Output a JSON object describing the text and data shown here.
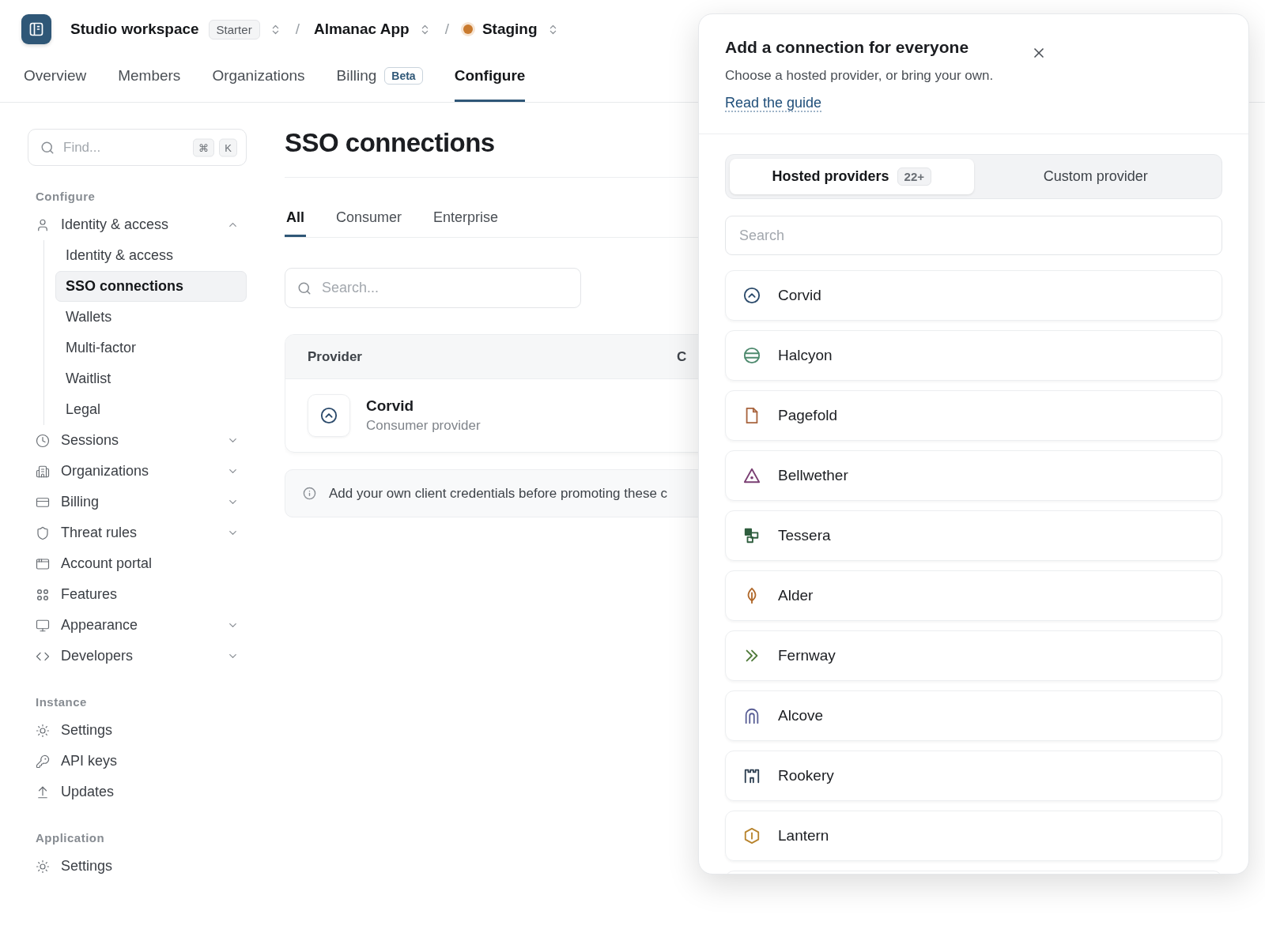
{
  "topbar": {
    "workspace": "Studio workspace",
    "plan": "Starter",
    "separator_1": "/",
    "app": "Almanac App",
    "separator_2": "/",
    "environment": "Staging"
  },
  "nav_tabs": [
    {
      "label": "Overview",
      "selected": false
    },
    {
      "label": "Members",
      "selected": false
    },
    {
      "label": "Organizations",
      "selected": false
    },
    {
      "label": "Billing",
      "badge": "Beta",
      "selected": false
    },
    {
      "label": "Configure",
      "selected": true
    }
  ],
  "sidebar": {
    "search": {
      "placeholder": "Find...",
      "keys": [
        "⌘",
        "K"
      ]
    },
    "sections": [
      {
        "title": "Configure",
        "items": [
          {
            "label": "Identity & access",
            "kind": "group",
            "expanded": true,
            "selected": false,
            "children": [
              {
                "label": "Identity & access",
                "selected": false
              },
              {
                "label": "SSO connections",
                "selected": true
              },
              {
                "label": "Wallets",
                "selected": false
              },
              {
                "label": "Multi-factor",
                "selected": false
              },
              {
                "label": "Waitlist",
                "selected": false
              },
              {
                "label": "Legal",
                "selected": false
              }
            ]
          },
          {
            "label": "Sessions",
            "kind": "group",
            "expanded": false,
            "selected": false
          },
          {
            "label": "Organizations",
            "kind": "group",
            "expanded": false,
            "selected": false
          },
          {
            "label": "Billing",
            "kind": "group",
            "expanded": false,
            "selected": false
          },
          {
            "label": "Threat rules",
            "kind": "group",
            "expanded": false,
            "selected": false
          },
          {
            "label": "Account portal",
            "kind": "link",
            "selected": false
          },
          {
            "label": "Features",
            "kind": "link",
            "selected": false
          },
          {
            "label": "Appearance",
            "kind": "group",
            "expanded": false,
            "selected": false
          },
          {
            "label": "Developers",
            "kind": "group",
            "expanded": false,
            "selected": false
          }
        ]
      },
      {
        "title": "Instance",
        "items": [
          {
            "label": "Settings",
            "kind": "link",
            "selected": false
          },
          {
            "label": "API keys",
            "kind": "link",
            "selected": false
          },
          {
            "label": "Updates",
            "kind": "link",
            "selected": false
          }
        ]
      },
      {
        "title": "Application",
        "items": [
          {
            "label": "Settings",
            "kind": "link",
            "selected": false
          }
        ]
      }
    ]
  },
  "main": {
    "title": "SSO connections",
    "tabs": [
      {
        "label": "All",
        "selected": true
      },
      {
        "label": "Consumer",
        "selected": false
      },
      {
        "label": "Enterprise",
        "selected": false
      }
    ],
    "search": {
      "placeholder": "Search..."
    },
    "table": {
      "columns": [
        "Provider",
        "C"
      ],
      "rows": [
        {
          "name": "Corvid",
          "description": "Consumer provider"
        }
      ]
    },
    "notice": "Add your own client credentials before promoting these c"
  },
  "panel": {
    "title": "Add a connection for everyone",
    "subtitle": "Choose a hosted provider, or bring your own.",
    "link": "Read the guide",
    "segments": [
      {
        "label": "Hosted providers",
        "count": "22+",
        "selected": true
      },
      {
        "label": "Custom provider",
        "selected": false
      }
    ],
    "search": {
      "placeholder": "Search"
    },
    "providers": [
      {
        "name": "Corvid",
        "color": "#2b4a6b"
      },
      {
        "name": "Halcyon",
        "color": "#4e8a6e"
      },
      {
        "name": "Pagefold",
        "color": "#a8643e"
      },
      {
        "name": "Bellwether",
        "color": "#7a3f73"
      },
      {
        "name": "Tessera",
        "color": "#2f5e3e"
      },
      {
        "name": "Alder",
        "color": "#b0682a"
      },
      {
        "name": "Fernway",
        "color": "#4f7a3a"
      },
      {
        "name": "Alcove",
        "color": "#5a5f96"
      },
      {
        "name": "Rookery",
        "color": "#2c3e50"
      },
      {
        "name": "Lantern",
        "color": "#b8842e"
      }
    ]
  }
}
